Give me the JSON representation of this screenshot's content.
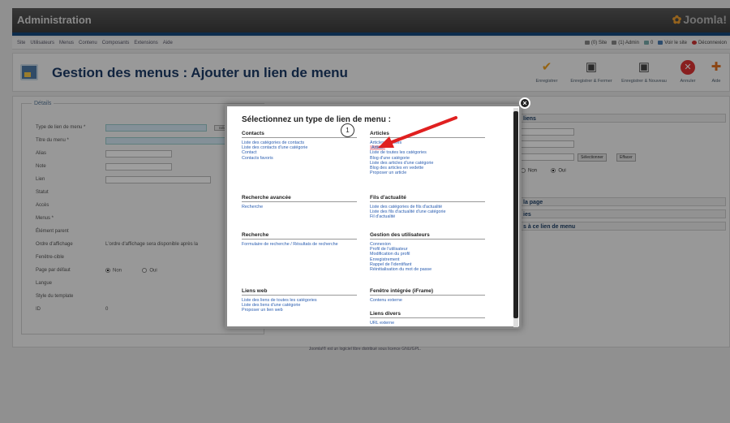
{
  "header": {
    "title": "Administration",
    "logo": "Joomla!"
  },
  "menubar": {
    "items": [
      "Site",
      "Utilisateurs",
      "Menus",
      "Contenu",
      "Composants",
      "Extensions",
      "Aide"
    ],
    "status": [
      "(0) Site",
      "(1) Admin",
      "0",
      "Voir le site",
      "Déconnexion"
    ]
  },
  "toolbar": {
    "page_title": "Gestion des menus : Ajouter un lien de menu",
    "buttons": [
      "Enregistrer",
      "Enregistrer & Fermer",
      "Enregistrer & Nouveau",
      "Annuler",
      "Aide"
    ]
  },
  "form": {
    "legend": "Détails",
    "rows": [
      "Type de lien de menu *",
      "Titre du menu *",
      "Alias",
      "Note",
      "Lien",
      "Statut",
      "Accès",
      "Menus *",
      "Élément parent",
      "Ordre d'affichage",
      "Fenêtre-cible",
      "Page par défaut",
      "Langue",
      "Style du template",
      "ID"
    ],
    "select_label": "Sélection",
    "order_text": "L'ordre d'affichage sera disponible après la",
    "non": "Non",
    "oui": "Oui",
    "id_value": "0"
  },
  "right": {
    "liens": "liens",
    "select": "Sélectionner",
    "effacer": "Effacer",
    "non": "Non",
    "oui": "Oui",
    "page": "la page",
    "ies": "ies",
    "assoc": "s à ce lien de menu"
  },
  "footer": "Joomla!® est un logiciel libre distribué sous licence GNU/GPL.",
  "modal": {
    "title": "Sélectionnez un type de lien de menu :",
    "badge": "1",
    "close": "×",
    "left": [
      {
        "heading": "Contacts",
        "links": [
          "Liste des catégories de contacts",
          "Liste des contacts d'une catégorie",
          "Contact",
          "Contacts favoris"
        ]
      },
      {
        "heading": "Recherche avancée",
        "links": [
          "Recherche"
        ]
      },
      {
        "heading": "Recherche",
        "links": [
          "Formulaire de recherche / Résultats de recherche"
        ]
      },
      {
        "heading": "Liens web",
        "links": [
          "Liste des liens de toutes les catégories",
          "Liste des liens d'une catégorie",
          "Proposer un lien web"
        ]
      }
    ],
    "right": [
      {
        "heading": "Articles",
        "links": [
          "Articles archivés",
          "Article",
          "Liste de toutes les catégories",
          "Blog d'une catégorie",
          "Liste des articles d'une catégorie",
          "Blog des articles en vedette",
          "Proposer un article"
        ]
      },
      {
        "heading": "Fils d'actualité",
        "links": [
          "Liste des catégories de fils d'actualité",
          "Liste des fils d'actualité d'une catégorie",
          "Fil d'actualité"
        ]
      },
      {
        "heading": "Gestion des utilisateurs",
        "links": [
          "Connexion",
          "Profil de l'utilisateur",
          "Modification du profil",
          "Enregistrement",
          "Rappel de l'identifiant",
          "Réinitialisation du mot de passe"
        ]
      },
      {
        "heading": "Fenêtre intégrée (iFrame)",
        "links": [
          "Contenu externe"
        ]
      },
      {
        "heading": "Liens divers",
        "links": [
          "URL externe"
        ]
      }
    ]
  },
  "colors": {
    "accent": "#15497c",
    "link": "#2a5db0",
    "highlight": "#f4b9c0",
    "arrow": "#e02020"
  }
}
